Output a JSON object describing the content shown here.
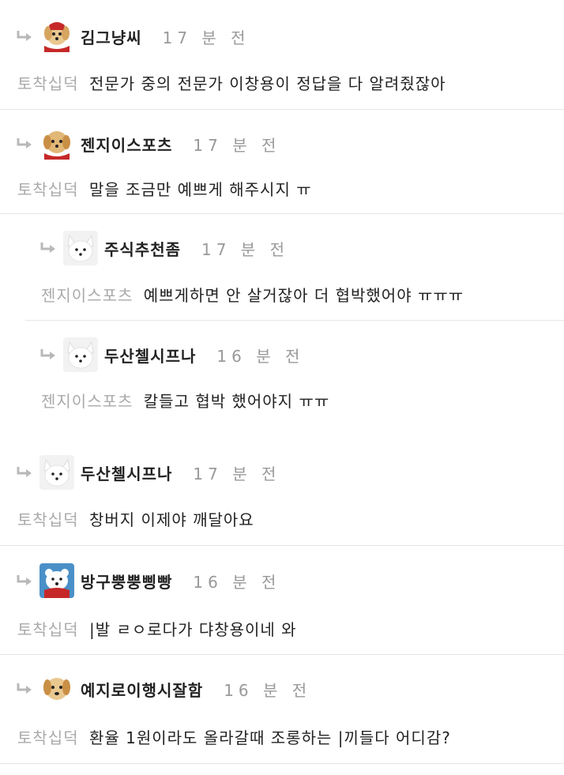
{
  "comments": [
    {
      "nick": "김그냥씨",
      "time": "17 분 전",
      "reply_to": "토착십덕",
      "text": "전문가 중의 전문가 이창용이 정답을 다 알려줬잖아",
      "avatar": "puppy-red-scarf-icon",
      "indent": false
    },
    {
      "nick": "젠지이스포츠",
      "time": "17 분 전",
      "reply_to": "토착십덕",
      "text": "말을 조금만 예쁘게 해주시지 ㅠ",
      "avatar": "puppy-red-scarf-icon",
      "indent": false
    },
    {
      "nick": "주식추천좀",
      "time": "17 분 전",
      "reply_to": "젠지이스포츠",
      "text": "예쁘게하면 안 살거잖아 더 협박했어야 ㅠㅠㅠ",
      "avatar": "white-fox-icon",
      "indent": true
    },
    {
      "nick": "두산첼시프나",
      "time": "16 분 전",
      "reply_to": "젠지이스포츠",
      "text": "칼들고 협박 했어야지 ㅠㅠ",
      "avatar": "white-fox-icon",
      "indent": true
    },
    {
      "nick": "두산첼시프나",
      "time": "17 분 전",
      "reply_to": "토착십덕",
      "text": "창버지 이제야 깨달아요",
      "avatar": "white-fox-icon",
      "indent": false
    },
    {
      "nick": "방구뿡뿡삥빵",
      "time": "16 분 전",
      "reply_to": "토착십덕",
      "text": "|발 ㄹㅇ로다가 댜창용이네 와",
      "avatar": "polar-bear-icon",
      "indent": false
    },
    {
      "nick": "예지로이행시잘함",
      "time": "16 분 전",
      "reply_to": "토착십덕",
      "text": "환율 1원이라도 올라갈때 조롱하는 |끼들다 어디감?",
      "avatar": "puppy-icon",
      "indent": false
    }
  ],
  "colors": {
    "nick": "#222222",
    "time": "#999999",
    "reply_to": "#aaaaaa",
    "divider": "#e6e6e6",
    "arrow": "#b8b8b8"
  }
}
